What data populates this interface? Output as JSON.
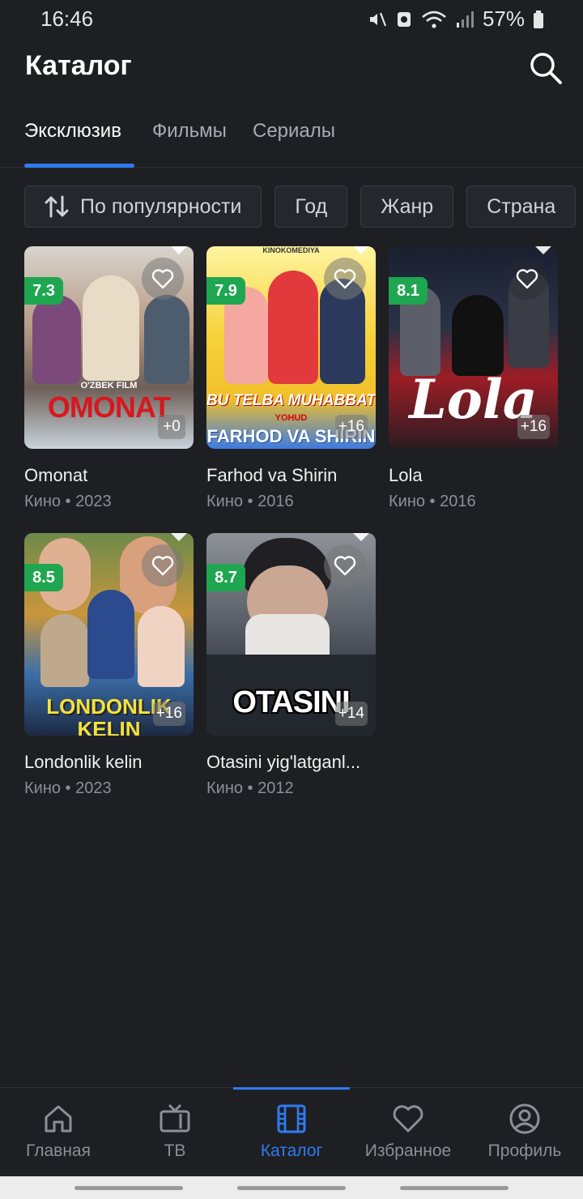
{
  "status_bar": {
    "time": "16:46",
    "battery": "57%"
  },
  "header": {
    "title": "Каталог"
  },
  "tabs": [
    {
      "label": "Эксклюзив",
      "active": true
    },
    {
      "label": "Фильмы",
      "active": false
    },
    {
      "label": "Сериалы",
      "active": false
    }
  ],
  "filters": [
    {
      "label": "По популярности",
      "icon": "sort-icon"
    },
    {
      "label": "Год"
    },
    {
      "label": "Жанр"
    },
    {
      "label": "Страна"
    }
  ],
  "movies": [
    {
      "title": "Omonat",
      "meta": "Кино • 2023",
      "rating": "7.3",
      "age": "+0",
      "poster_text": "OMONAT",
      "poster_sub": "O'ZBEK FILM"
    },
    {
      "title": "Farhod va Shirin",
      "meta": "Кино • 2016",
      "rating": "7.9",
      "age": "+16",
      "poster_text": "BU TELBA MUHABBAT",
      "poster_sub": "YOHUD",
      "poster_text2": "FARHOD VA SHIRIN",
      "poster_top": "KINOKOMEDIYA"
    },
    {
      "title": "Lola",
      "meta": "Кино • 2016",
      "rating": "8.1",
      "age": "+16",
      "poster_text": "Lola"
    },
    {
      "title": "Londonlik kelin",
      "meta": "Кино • 2023",
      "rating": "8.5",
      "age": "+16",
      "poster_text": "LONDONLIK KELIN"
    },
    {
      "title": "Otasini yig'latganl...",
      "meta": "Кино • 2012",
      "rating": "8.7",
      "age": "+14",
      "poster_text": "OTASINI"
    }
  ],
  "bottom_nav": [
    {
      "label": "Главная",
      "icon": "home-icon"
    },
    {
      "label": "ТВ",
      "icon": "tv-icon"
    },
    {
      "label": "Каталог",
      "icon": "film-icon",
      "active": true
    },
    {
      "label": "Избранное",
      "icon": "heart-icon"
    },
    {
      "label": "Профиль",
      "icon": "profile-icon"
    }
  ],
  "colors": {
    "accent": "#2f7bf2",
    "rating_badge": "#1fa650",
    "background": "#1e1f23"
  }
}
